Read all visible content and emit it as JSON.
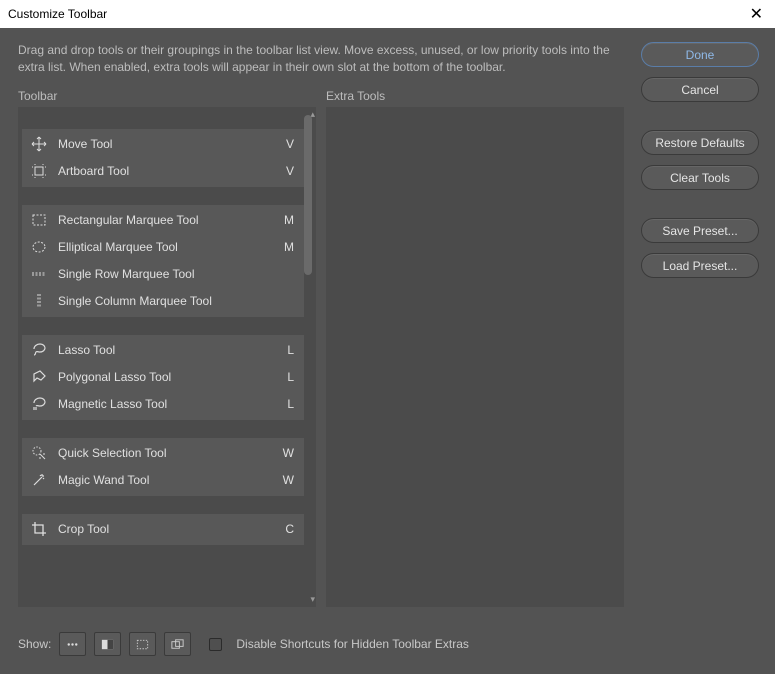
{
  "window": {
    "title": "Customize Toolbar",
    "description": "Drag and drop tools or their groupings in the toolbar list view. Move excess, unused, or low priority tools into the extra list. When enabled, extra tools will appear in their own slot at the bottom of the toolbar."
  },
  "columns": {
    "toolbar_label": "Toolbar",
    "extra_label": "Extra Tools"
  },
  "buttons": {
    "done": "Done",
    "cancel": "Cancel",
    "restore": "Restore Defaults",
    "clear": "Clear Tools",
    "save_preset": "Save Preset...",
    "load_preset": "Load Preset..."
  },
  "footer": {
    "show_label": "Show:",
    "checkbox_label": "Disable Shortcuts for Hidden Toolbar Extras"
  },
  "tool_groups": [
    {
      "tools": [
        {
          "icon": "move-icon",
          "name": "Move Tool",
          "key": "V"
        },
        {
          "icon": "artboard-icon",
          "name": "Artboard Tool",
          "key": "V"
        }
      ]
    },
    {
      "tools": [
        {
          "icon": "rect-marquee-icon",
          "name": "Rectangular Marquee Tool",
          "key": "M"
        },
        {
          "icon": "ellipse-marquee-icon",
          "name": "Elliptical Marquee Tool",
          "key": "M"
        },
        {
          "icon": "row-marquee-icon",
          "name": "Single Row Marquee Tool",
          "key": ""
        },
        {
          "icon": "col-marquee-icon",
          "name": "Single Column Marquee Tool",
          "key": ""
        }
      ]
    },
    {
      "tools": [
        {
          "icon": "lasso-icon",
          "name": "Lasso Tool",
          "key": "L"
        },
        {
          "icon": "poly-lasso-icon",
          "name": "Polygonal Lasso Tool",
          "key": "L"
        },
        {
          "icon": "mag-lasso-icon",
          "name": "Magnetic Lasso Tool",
          "key": "L"
        }
      ]
    },
    {
      "tools": [
        {
          "icon": "quick-select-icon",
          "name": "Quick Selection Tool",
          "key": "W"
        },
        {
          "icon": "wand-icon",
          "name": "Magic Wand Tool",
          "key": "W"
        }
      ]
    },
    {
      "tools": [
        {
          "icon": "crop-icon",
          "name": "Crop Tool",
          "key": "C"
        }
      ]
    }
  ]
}
